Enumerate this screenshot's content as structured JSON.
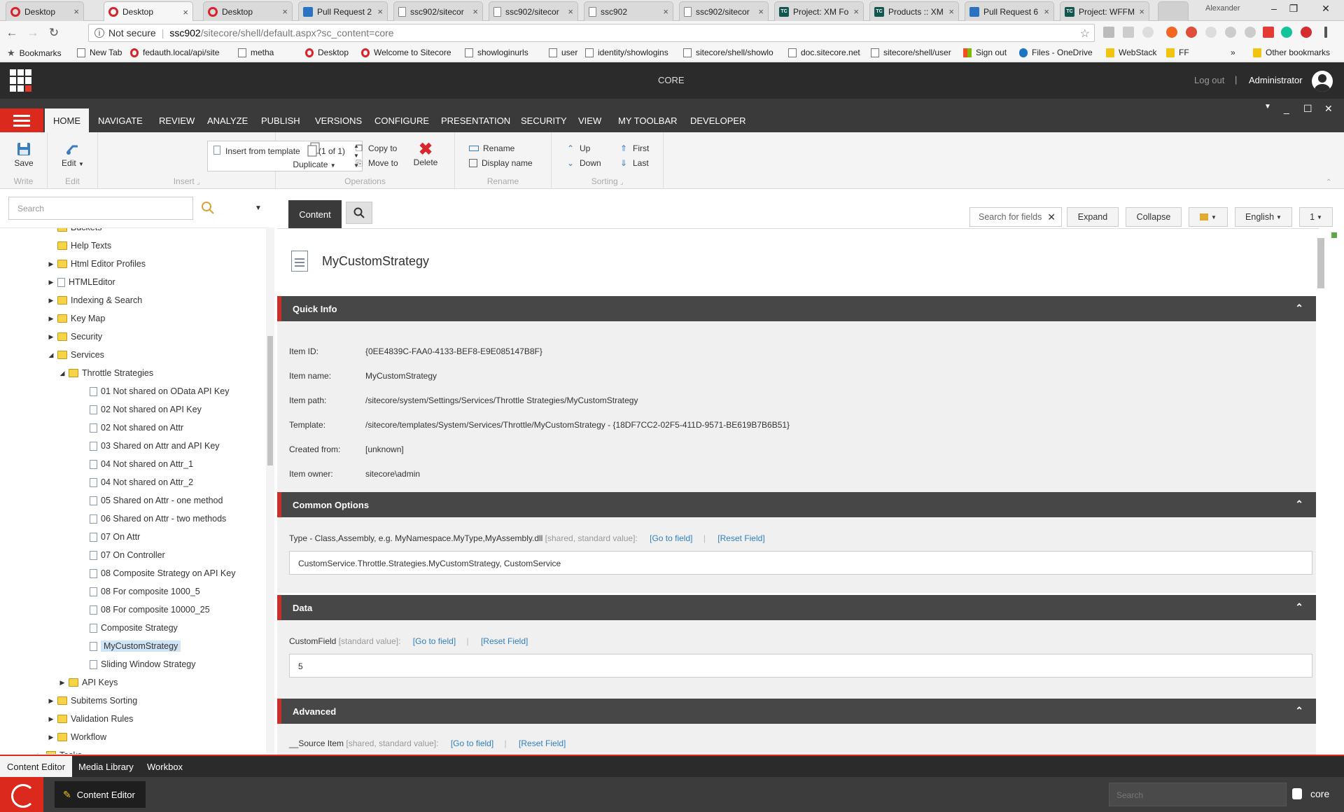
{
  "browser": {
    "tabs": [
      {
        "label": "Desktop",
        "icon": "opera"
      },
      {
        "label": "Desktop",
        "icon": "opera"
      },
      {
        "label": "Desktop",
        "icon": "opera"
      },
      {
        "label": "Pull Request 2",
        "icon": "vsts"
      },
      {
        "label": "ssc902/sitecor",
        "icon": "doc"
      },
      {
        "label": "ssc902/sitecor",
        "icon": "doc"
      },
      {
        "label": "ssc902",
        "icon": "doc"
      },
      {
        "label": "ssc902/sitecor",
        "icon": "doc"
      },
      {
        "label": "Project: XM Fo",
        "icon": "tc"
      },
      {
        "label": "Products :: XM",
        "icon": "tc"
      },
      {
        "label": "Pull Request 6",
        "icon": "vsts"
      },
      {
        "label": "Project: WFFM",
        "icon": "tc"
      }
    ],
    "profile_name": "Alexander",
    "address": {
      "security": "Not secure",
      "host": "ssc902",
      "path": "/sitecore/shell/default.aspx?sc_content=core"
    },
    "bookmarks": [
      {
        "label": "Bookmarks",
        "icon": "star"
      },
      {
        "label": "New Tab",
        "icon": "page"
      },
      {
        "label": "fedauth.local/api/site",
        "icon": "opera"
      },
      {
        "label": "metha",
        "icon": "page"
      },
      {
        "label": "Desktop",
        "icon": "opera"
      },
      {
        "label": "Welcome to Sitecore",
        "icon": "opera"
      },
      {
        "label": "showloginurls",
        "icon": "page"
      },
      {
        "label": "user",
        "icon": "page"
      },
      {
        "label": "identity/showlogins",
        "icon": "page"
      },
      {
        "label": "sitecore/shell/showlo",
        "icon": "page"
      },
      {
        "label": "doc.sitecore.net",
        "icon": "page"
      },
      {
        "label": "sitecore/shell/user",
        "icon": "page"
      },
      {
        "label": "Sign out",
        "icon": "win"
      },
      {
        "label": "Files - OneDrive",
        "icon": "cloud"
      },
      {
        "label": "WebStack",
        "icon": "folder"
      },
      {
        "label": "FF",
        "icon": "folder"
      }
    ],
    "more_bookmarks": "»",
    "other_bookmarks": "Other bookmarks"
  },
  "header": {
    "database": "CORE",
    "logout": "Log out",
    "separator": "|",
    "user": "Administrator"
  },
  "ribbon": {
    "tabs": [
      "HOME",
      "NAVIGATE",
      "REVIEW",
      "ANALYZE",
      "PUBLISH",
      "VERSIONS",
      "CONFIGURE",
      "PRESENTATION",
      "SECURITY",
      "VIEW",
      "MY TOOLBAR",
      "DEVELOPER"
    ],
    "active_tab": "HOME",
    "groups": {
      "write": {
        "title": "Write",
        "save": "Save"
      },
      "edit": {
        "title": "Edit",
        "edit": "Edit"
      },
      "insert": {
        "title": "Insert",
        "item": "Insert from template",
        "count": "(1 of 1)"
      },
      "operations": {
        "title": "Operations",
        "duplicate": "Duplicate",
        "copy_to": "Copy to",
        "move_to": "Move to",
        "delete": "Delete"
      },
      "rename": {
        "title": "Rename",
        "rename": "Rename",
        "display_name": "Display name"
      },
      "sorting": {
        "title": "Sorting",
        "up": "Up",
        "down": "Down",
        "first": "First",
        "last": "Last"
      }
    }
  },
  "tree": {
    "search_placeholder": "Search",
    "nodes": [
      {
        "label": "Buckets",
        "level": 2,
        "expander": "",
        "icon": "folder"
      },
      {
        "label": "Help Texts",
        "level": 2,
        "expander": "",
        "icon": "folder"
      },
      {
        "label": "Html Editor Profiles",
        "level": 2,
        "expander": "▶",
        "icon": "folder"
      },
      {
        "label": "HTMLEditor",
        "level": 2,
        "expander": "▶",
        "icon": "doc"
      },
      {
        "label": "Indexing & Search",
        "level": 2,
        "expander": "▶",
        "icon": "folder"
      },
      {
        "label": "Key Map",
        "level": 2,
        "expander": "▶",
        "icon": "folder"
      },
      {
        "label": "Security",
        "level": 2,
        "expander": "▶",
        "icon": "folder"
      },
      {
        "label": "Services",
        "level": 2,
        "expander": "◢",
        "icon": "folder"
      },
      {
        "label": "Throttle Strategies",
        "level": 3,
        "expander": "◢",
        "icon": "cfg"
      },
      {
        "label": "01 Not shared on OData API Key",
        "level": 4,
        "expander": "",
        "icon": "doc"
      },
      {
        "label": "02 Not shared on API Key",
        "level": 4,
        "expander": "",
        "icon": "doc"
      },
      {
        "label": "02 Not shared on Attr",
        "level": 4,
        "expander": "",
        "icon": "doc"
      },
      {
        "label": "03 Shared on Attr and API Key",
        "level": 4,
        "expander": "",
        "icon": "doc"
      },
      {
        "label": "04 Not shared on Attr_1",
        "level": 4,
        "expander": "",
        "icon": "doc"
      },
      {
        "label": "04 Not shared on Attr_2",
        "level": 4,
        "expander": "",
        "icon": "doc"
      },
      {
        "label": "05 Shared on Attr - one method",
        "level": 4,
        "expander": "",
        "icon": "doc"
      },
      {
        "label": "06 Shared on Attr - two methods",
        "level": 4,
        "expander": "",
        "icon": "doc"
      },
      {
        "label": "07 On Attr",
        "level": 4,
        "expander": "",
        "icon": "doc"
      },
      {
        "label": "07 On Controller",
        "level": 4,
        "expander": "",
        "icon": "doc"
      },
      {
        "label": "08 Composite Strategy on API Key",
        "level": 4,
        "expander": "",
        "icon": "doc"
      },
      {
        "label": "08 For composite 1000_5",
        "level": 4,
        "expander": "",
        "icon": "doc"
      },
      {
        "label": "08 For composite 10000_25",
        "level": 4,
        "expander": "",
        "icon": "doc"
      },
      {
        "label": "Composite Strategy",
        "level": 4,
        "expander": "",
        "icon": "doc"
      },
      {
        "label": "MyCustomStrategy",
        "level": 4,
        "expander": "",
        "icon": "doc",
        "selected": true
      },
      {
        "label": "Sliding Window Strategy",
        "level": 4,
        "expander": "",
        "icon": "doc"
      },
      {
        "label": "API Keys",
        "level": 3,
        "expander": "▶",
        "icon": "folder"
      },
      {
        "label": "Subitems Sorting",
        "level": 2,
        "expander": "▶",
        "icon": "folder"
      },
      {
        "label": "Validation Rules",
        "level": 2,
        "expander": "▶",
        "icon": "folder"
      },
      {
        "label": "Workflow",
        "level": 2,
        "expander": "▶",
        "icon": "folder"
      },
      {
        "label": "Tasks",
        "level": 1,
        "expander": "▶",
        "icon": "cfg"
      }
    ]
  },
  "editor": {
    "tab_content": "Content",
    "search_fields_placeholder": "Search for fields",
    "expand": "Expand",
    "collapse": "Collapse",
    "language": "English",
    "version": "1",
    "item_title": "MyCustomStrategy",
    "quick_info": {
      "title": "Quick Info",
      "rows": [
        {
          "label": "Item ID:",
          "value": "{0EE4839C-FAA0-4133-BEF8-E9E085147B8F}"
        },
        {
          "label": "Item name:",
          "value": "MyCustomStrategy"
        },
        {
          "label": "Item path:",
          "value": "/sitecore/system/Settings/Services/Throttle Strategies/MyCustomStrategy"
        },
        {
          "label": "Template:",
          "value": "/sitecore/templates/System/Services/Throttle/MyCustomStrategy - {18DF7CC2-02F5-411D-9571-BE619B7B6B51}"
        },
        {
          "label": "Created from:",
          "value": "[unknown]"
        },
        {
          "label": "Item owner:",
          "value": "sitecore\\admin"
        }
      ]
    },
    "common_options": {
      "title": "Common Options",
      "field_label": "Type - Class,Assembly, e.g. MyNamespace.MyType,MyAssembly.dll",
      "field_meta": "[shared, standard value]:",
      "goto": "[Go to field]",
      "reset": "[Reset Field]",
      "value": "CustomService.Throttle.Strategies.MyCustomStrategy, CustomService"
    },
    "data": {
      "title": "Data",
      "field_label": "CustomField",
      "field_meta": "[standard value]:",
      "goto": "[Go to field]",
      "reset": "[Reset Field]",
      "value": "5"
    },
    "advanced": {
      "title": "Advanced",
      "field_label": "__Source Item",
      "field_meta": "[shared, standard value]:",
      "goto": "[Go to field]",
      "reset": "[Reset Field]"
    }
  },
  "bottom": {
    "tabs": [
      "Content Editor",
      "Media Library",
      "Workbox"
    ],
    "task": "Content Editor",
    "search_placeholder": "Search",
    "database": "core"
  },
  "colors": {
    "accent": "#dc291e",
    "dark": "#2b2b2b",
    "link": "#2f7fc1"
  }
}
